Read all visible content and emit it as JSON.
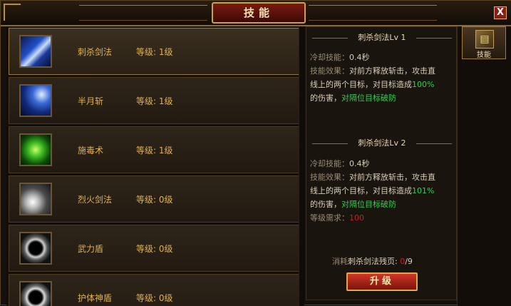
{
  "window": {
    "title": "技能",
    "close_label": "X"
  },
  "skills": [
    {
      "name": "刺杀剑法",
      "level": "等级: 1级",
      "icon": "sword-thrust-icon",
      "selected": true
    },
    {
      "name": "半月斩",
      "level": "等级: 1级",
      "icon": "half-moon-slash-icon"
    },
    {
      "name": "施毒术",
      "level": "等级: 1级",
      "icon": "poison-skull-icon"
    },
    {
      "name": "烈火剑法",
      "level": "等级: 0级",
      "icon": "fire-sword-icon"
    },
    {
      "name": "武力盾",
      "level": "等级: 0级",
      "icon": "force-shield-icon"
    },
    {
      "name": "护体神盾",
      "level": "等级: 0级",
      "icon": "guardian-shield-icon"
    }
  ],
  "detail": {
    "current": {
      "header": "刺杀剑法Lv 1",
      "cooldown_label": "冷却技能：",
      "cooldown_value": "0.4秒",
      "effect_label": "技能效果：",
      "effect_text_1": "对前方释放斩击，攻击直",
      "effect_text_2": "线上的两个目标，对目标造成",
      "effect_pct": "100%",
      "effect_text_3": "的伤害，",
      "effect_green": "对隔位目标破防"
    },
    "next": {
      "header": "刺杀剑法Lv 2",
      "cooldown_label": "冷却技能：",
      "cooldown_value": "0.4秒",
      "effect_label": "技能效果：",
      "effect_text_1": "对前方释放斩击，攻击直",
      "effect_text_2": "线上的两个目标，对目标造成",
      "effect_pct": "101%",
      "effect_text_3": "的伤害，",
      "effect_green": "对隔位目标破防",
      "req_label": "等级需求：",
      "req_value": "100"
    },
    "cost_label": "消耗",
    "cost_item": "刺杀剑法残页:",
    "cost_have": "0",
    "cost_need": "/9",
    "upgrade_label": "升级"
  },
  "side": {
    "tab_label": "技能",
    "tab_icon": "skill-book-icon"
  },
  "colors": {
    "accent_gold": "#e0b050",
    "green": "#2ad24a",
    "red": "#c82222",
    "button_red": "#d03626"
  }
}
